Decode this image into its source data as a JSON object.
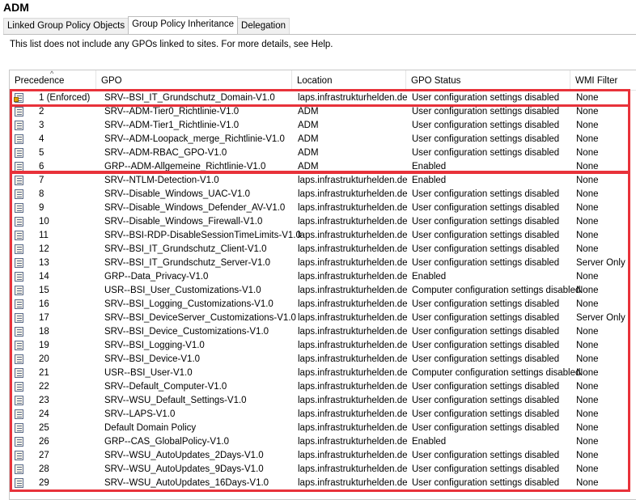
{
  "title": "ADM",
  "tabs": [
    "Linked Group Policy Objects",
    "Group Policy Inheritance",
    "Delegation"
  ],
  "note": "This list does not include any GPOs linked to sites. For more details, see Help.",
  "columns": [
    "Precedence",
    "GPO",
    "Location",
    "GPO Status",
    "WMI Filter"
  ],
  "rows": [
    {
      "prec": "1  (Enforced)",
      "gpo": "SRV--BSI_IT_Grundschutz_Domain-V1.0",
      "loc": "laps.infrastrukturhelden.de",
      "status": "User configuration settings disabled",
      "wmi": "None",
      "lock": true
    },
    {
      "prec": "2",
      "gpo": "SRV--ADM-Tier0_Richtlinie-V1.0",
      "loc": "ADM",
      "status": "User configuration settings disabled",
      "wmi": "None"
    },
    {
      "prec": "3",
      "gpo": "SRV--ADM-Tier1_Richtlinie-V1.0",
      "loc": "ADM",
      "status": "User configuration settings disabled",
      "wmi": "None"
    },
    {
      "prec": "4",
      "gpo": "SRV--ADM-Loopack_merge_Richtlinie-V1.0",
      "loc": "ADM",
      "status": "User configuration settings disabled",
      "wmi": "None"
    },
    {
      "prec": "5",
      "gpo": "SRV--ADM-RBAC_GPO-V1.0",
      "loc": "ADM",
      "status": "User configuration settings disabled",
      "wmi": "None"
    },
    {
      "prec": "6",
      "gpo": "GRP--ADM-Allgemeine_Richtlinie-V1.0",
      "loc": "ADM",
      "status": "Enabled",
      "wmi": "None"
    },
    {
      "prec": "7",
      "gpo": "SRV--NTLM-Detection-V1.0",
      "loc": "laps.infrastrukturhelden.de",
      "status": "Enabled",
      "wmi": "None"
    },
    {
      "prec": "8",
      "gpo": "SRV--Disable_Windows_UAC-V1.0",
      "loc": "laps.infrastrukturhelden.de",
      "status": "User configuration settings disabled",
      "wmi": "None"
    },
    {
      "prec": "9",
      "gpo": "SRV--Disable_Windows_Defender_AV-V1.0",
      "loc": "laps.infrastrukturhelden.de",
      "status": "User configuration settings disabled",
      "wmi": "None"
    },
    {
      "prec": "10",
      "gpo": "SRV--Disable_Windows_Firewall-V1.0",
      "loc": "laps.infrastrukturhelden.de",
      "status": "User configuration settings disabled",
      "wmi": "None"
    },
    {
      "prec": "11",
      "gpo": "SRV--BSI-RDP-DisableSessionTimeLimits-V1.0",
      "loc": "laps.infrastrukturhelden.de",
      "status": "User configuration settings disabled",
      "wmi": "None"
    },
    {
      "prec": "12",
      "gpo": "SRV--BSI_IT_Grundschutz_Client-V1.0",
      "loc": "laps.infrastrukturhelden.de",
      "status": "User configuration settings disabled",
      "wmi": "None"
    },
    {
      "prec": "13",
      "gpo": "SRV--BSI_IT_Grundschutz_Server-V1.0",
      "loc": "laps.infrastrukturhelden.de",
      "status": "User configuration settings disabled",
      "wmi": "Server Only"
    },
    {
      "prec": "14",
      "gpo": "GRP--Data_Privacy-V1.0",
      "loc": "laps.infrastrukturhelden.de",
      "status": "Enabled",
      "wmi": "None"
    },
    {
      "prec": "15",
      "gpo": "USR--BSI_User_Customizations-V1.0",
      "loc": "laps.infrastrukturhelden.de",
      "status": "Computer configuration settings disabled",
      "wmi": "None"
    },
    {
      "prec": "16",
      "gpo": "SRV--BSI_Logging_Customizations-V1.0",
      "loc": "laps.infrastrukturhelden.de",
      "status": "User configuration settings disabled",
      "wmi": "None"
    },
    {
      "prec": "17",
      "gpo": "SRV--BSI_DeviceServer_Customizations-V1.0",
      "loc": "laps.infrastrukturhelden.de",
      "status": "User configuration settings disabled",
      "wmi": "Server Only"
    },
    {
      "prec": "18",
      "gpo": "SRV--BSI_Device_Customizations-V1.0",
      "loc": "laps.infrastrukturhelden.de",
      "status": "User configuration settings disabled",
      "wmi": "None"
    },
    {
      "prec": "19",
      "gpo": "SRV--BSI_Logging-V1.0",
      "loc": "laps.infrastrukturhelden.de",
      "status": "User configuration settings disabled",
      "wmi": "None"
    },
    {
      "prec": "20",
      "gpo": "SRV--BSI_Device-V1.0",
      "loc": "laps.infrastrukturhelden.de",
      "status": "User configuration settings disabled",
      "wmi": "None"
    },
    {
      "prec": "21",
      "gpo": "USR--BSI_User-V1.0",
      "loc": "laps.infrastrukturhelden.de",
      "status": "Computer configuration settings disabled",
      "wmi": "None"
    },
    {
      "prec": "22",
      "gpo": "SRV--Default_Computer-V1.0",
      "loc": "laps.infrastrukturhelden.de",
      "status": "User configuration settings disabled",
      "wmi": "None"
    },
    {
      "prec": "23",
      "gpo": "SRV--WSU_Default_Settings-V1.0",
      "loc": "laps.infrastrukturhelden.de",
      "status": "User configuration settings disabled",
      "wmi": "None"
    },
    {
      "prec": "24",
      "gpo": "SRV--LAPS-V1.0",
      "loc": "laps.infrastrukturhelden.de",
      "status": "User configuration settings disabled",
      "wmi": "None"
    },
    {
      "prec": "25",
      "gpo": "Default Domain Policy",
      "loc": "laps.infrastrukturhelden.de",
      "status": "User configuration settings disabled",
      "wmi": "None"
    },
    {
      "prec": "26",
      "gpo": "GRP--CAS_GlobalPolicy-V1.0",
      "loc": "laps.infrastrukturhelden.de",
      "status": "Enabled",
      "wmi": "None"
    },
    {
      "prec": "27",
      "gpo": "SRV--WSU_AutoUpdates_2Days-V1.0",
      "loc": "laps.infrastrukturhelden.de",
      "status": "User configuration settings disabled",
      "wmi": "None"
    },
    {
      "prec": "28",
      "gpo": "SRV--WSU_AutoUpdates_9Days-V1.0",
      "loc": "laps.infrastrukturhelden.de",
      "status": "User configuration settings disabled",
      "wmi": "None"
    },
    {
      "prec": "29",
      "gpo": "SRV--WSU_AutoUpdates_16Days-V1.0",
      "loc": "laps.infrastrukturhelden.de",
      "status": "User configuration settings disabled",
      "wmi": "None"
    }
  ],
  "highlight_color": "#e8323a"
}
